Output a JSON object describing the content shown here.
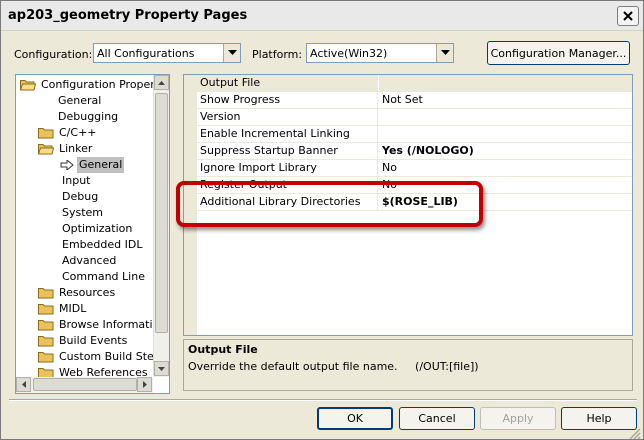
{
  "window": {
    "title": "ap203_geometry Property Pages"
  },
  "toolbar": {
    "configuration_label": "Configuration:",
    "configuration_value": "All Configurations",
    "platform_label": "Platform:",
    "platform_value": "Active(Win32)",
    "config_manager_label": "Configuration Manager..."
  },
  "tree": {
    "items": [
      {
        "label": "Configuration Properties",
        "indent": 0,
        "folder": true,
        "open": true
      },
      {
        "label": "General",
        "indent": 1,
        "folder": false
      },
      {
        "label": "Debugging",
        "indent": 1,
        "folder": false
      },
      {
        "label": "C/C++",
        "indent": 1,
        "folder": true
      },
      {
        "label": "Linker",
        "indent": 1,
        "folder": true,
        "open": true
      },
      {
        "label": "General",
        "indent": 2,
        "folder": false,
        "selected": true
      },
      {
        "label": "Input",
        "indent": 2,
        "folder": false
      },
      {
        "label": "Debug",
        "indent": 2,
        "folder": false
      },
      {
        "label": "System",
        "indent": 2,
        "folder": false
      },
      {
        "label": "Optimization",
        "indent": 2,
        "folder": false
      },
      {
        "label": "Embedded IDL",
        "indent": 2,
        "folder": false
      },
      {
        "label": "Advanced",
        "indent": 2,
        "folder": false
      },
      {
        "label": "Command Line",
        "indent": 2,
        "folder": false
      },
      {
        "label": "Resources",
        "indent": 1,
        "folder": true
      },
      {
        "label": "MIDL",
        "indent": 1,
        "folder": true
      },
      {
        "label": "Browse Information",
        "indent": 1,
        "folder": true
      },
      {
        "label": "Build Events",
        "indent": 1,
        "folder": true
      },
      {
        "label": "Custom Build Step",
        "indent": 1,
        "folder": true
      },
      {
        "label": "Web References",
        "indent": 1,
        "folder": true
      }
    ]
  },
  "grid": {
    "rows": [
      {
        "name": "Output File",
        "value": "",
        "selected": true
      },
      {
        "name": "Show Progress",
        "value": "Not Set"
      },
      {
        "name": "Version",
        "value": ""
      },
      {
        "name": "Enable Incremental Linking",
        "value": ""
      },
      {
        "name": "Suppress Startup Banner",
        "value": "Yes (/NOLOGO)",
        "bold": true
      },
      {
        "name": "Ignore Import Library",
        "value": "No"
      },
      {
        "name": "Register Output",
        "value": "No"
      },
      {
        "name": "Additional Library Directories",
        "value": "$(ROSE_LIB)",
        "bold": true
      }
    ]
  },
  "description": {
    "title": "Output File",
    "text": "Override the default output file name.     (/OUT:[file])"
  },
  "buttons": {
    "ok": "OK",
    "cancel": "Cancel",
    "apply": "Apply",
    "help": "Help"
  },
  "colors": {
    "highlight": "#c00000",
    "folder": "#e8c25a",
    "selection": "#c0c0c0"
  }
}
